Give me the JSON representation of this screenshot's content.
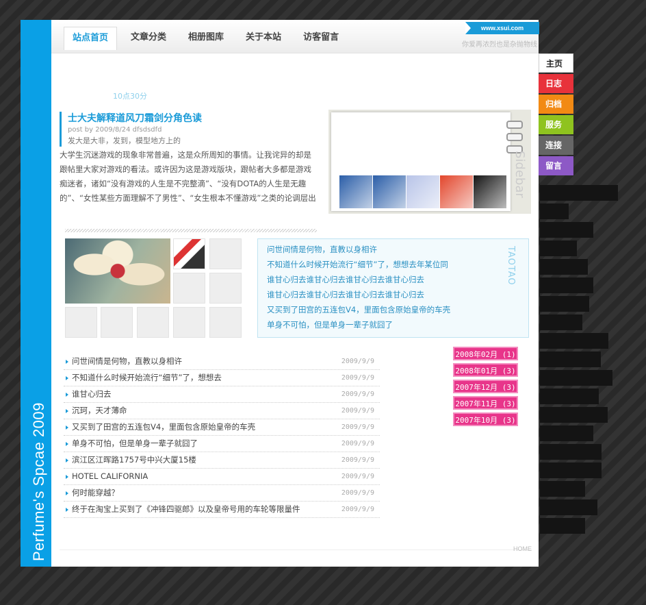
{
  "site": {
    "side_title": "Perfume's Spcae 2009",
    "url": "www.xsui.com",
    "slogan": "你爱再浓烈也是杂抛物线"
  },
  "nav": {
    "tabs": [
      "站点首页",
      "文章分类",
      "相册图库",
      "关于本站",
      "访客留言"
    ]
  },
  "right_nav": [
    {
      "label": "主页",
      "color": "#ffffff"
    },
    {
      "label": "日志",
      "color": "#e8323b"
    },
    {
      "label": "归档",
      "color": "#f28a14"
    },
    {
      "label": "服务",
      "color": "#8fc31f"
    },
    {
      "label": "连接",
      "color": "#666666"
    },
    {
      "label": "留言",
      "color": "#8d59c6"
    }
  ],
  "time_label": "10点30分",
  "post": {
    "title": "士大夫解释道风刀霜剑分角色读",
    "meta": "post by 2009/8/24 dfsdsdfd",
    "subtitle": "发大是大非，发到，模型地方上的",
    "body": "大学生沉迷游戏的现象非常普遍，这是众所周知的事情。让我诧异的却是跟帖里大家对游戏的看法。或许因为这是游戏版块，跟帖者大多都是游戏痴迷者，诸如“没有游戏的人生是不完整滴”、“没有DOTA的人生是无趣的”、“女性某些方面理解不了男性”、“女生根本不懂游戏”之类的论调层出不穷，花样百出。我看到的不是一群大学生在理性地思"
  },
  "sidebar_box": {
    "label": "Sidebar",
    "thumbs": [
      {
        "icon": "game-box-icon",
        "color": "#2b5ea8"
      },
      {
        "icon": "game-box-icon",
        "color": "#2b5ea8"
      },
      {
        "icon": "logo-card-icon",
        "color": "#b8c4e8"
      },
      {
        "icon": "goldfish-icon",
        "color": "#e2462c"
      },
      {
        "icon": "gate-icon",
        "color": "#151515"
      }
    ]
  },
  "quotes": {
    "label": "TAOTAO",
    "items": [
      "问世间情是何物，直教以身相许",
      "不知道什么时候开始流行“细节”了，想想去年某位同",
      "谁甘心归去谁甘心归去谁甘心归去谁甘心归去",
      "谁甘心归去谁甘心归去谁甘心归去谁甘心归去",
      "又买到了田宫的五连包V4，里面包含原始皇帝的车壳",
      "单身不可怕，但是单身一辈子就囧了"
    ]
  },
  "archives": [
    "2008年02月 (1)",
    "2008年01月 (3)",
    "2007年12月 (3)",
    "2007年11月 (3)",
    "2007年10月 (3)"
  ],
  "articles": [
    {
      "title": "问世间情是何物，直教以身相许",
      "date": "2009/9/9"
    },
    {
      "title": "不知道什么时候开始流行“细节”了，想想去",
      "date": "2009/9/9"
    },
    {
      "title": "谁甘心归去",
      "date": "2009/9/9"
    },
    {
      "title": "沉珂，天才薄命",
      "date": "2009/9/9"
    },
    {
      "title": "又买到了田宫的五连包V4，里面包含原始皇帝的车壳",
      "date": "2009/9/9"
    },
    {
      "title": "单身不可怕，但是单身一辈子就囧了",
      "date": "2009/9/9"
    },
    {
      "title": "滨江区江晖路1757号中兴大厦15楼",
      "date": "2009/9/9"
    },
    {
      "title": "HOTEL CALIFORNIA",
      "date": "2009/9/9"
    },
    {
      "title": "何时能穿越？",
      "date": "2009/9/9"
    },
    {
      "title": "终于在淘宝上买到了《冲锋四驱郎》以及皇帝号用的车轮等限量件",
      "date": "2009/9/9"
    }
  ],
  "footer": {
    "home": "HOME"
  }
}
